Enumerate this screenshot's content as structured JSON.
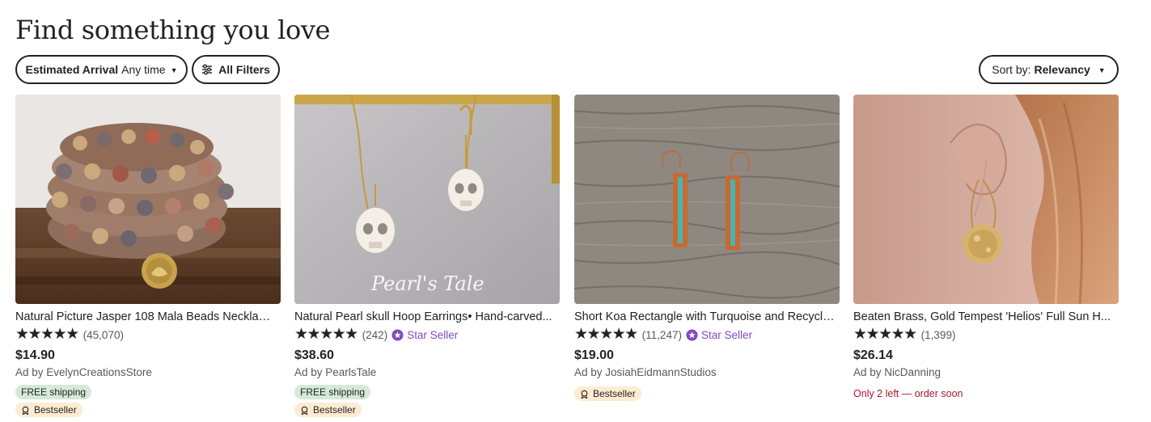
{
  "header": {
    "title": "Find something you love"
  },
  "filters": {
    "arrival_label": "Estimated Arrival",
    "arrival_value": "Any time",
    "all_filters_label": "All Filters",
    "sort_label": "Sort by:",
    "sort_value": "Relevancy"
  },
  "listings": [
    {
      "title": "Natural Picture Jasper 108 Mala Beads Necklace...",
      "stars": "★★★★★",
      "reviews": "(45,070)",
      "star_seller": "",
      "price": "$14.90",
      "seller": "Ad by EvelynCreationsStore",
      "shipping_tag": "FREE shipping",
      "bestseller_tag": "Bestseller",
      "stock_note": ""
    },
    {
      "title": "Natural Pearl skull Hoop Earrings• Hand-carved...",
      "stars": "★★★★★",
      "reviews": "(242)",
      "star_seller": "Star Seller",
      "price": "$38.60",
      "seller": "Ad by PearlsTale",
      "shipping_tag": "FREE shipping",
      "bestseller_tag": "Bestseller",
      "stock_note": "",
      "watermark": "Pearl's Tale"
    },
    {
      "title": "Short Koa Rectangle with Turquoise and Recycled...",
      "stars": "★★★★★",
      "reviews": "(11,247)",
      "star_seller": "Star Seller",
      "price": "$19.00",
      "seller": "Ad by JosiahEidmannStudios",
      "shipping_tag": "",
      "bestseller_tag": "Bestseller",
      "stock_note": ""
    },
    {
      "title": "Beaten Brass, Gold Tempest 'Helios' Full Sun H...",
      "stars": "★★★★★",
      "reviews": "(1,399)",
      "star_seller": "",
      "price": "$26.14",
      "seller": "Ad by NicDanning",
      "shipping_tag": "",
      "bestseller_tag": "",
      "stock_note": "Only 2 left — order soon"
    }
  ],
  "colors": {
    "star_seller": "#7f4ac4",
    "free_shipping_bg": "#d4e9d7",
    "bestseller_bg": "#fdebd2",
    "stock_warning": "#a61a2e"
  }
}
